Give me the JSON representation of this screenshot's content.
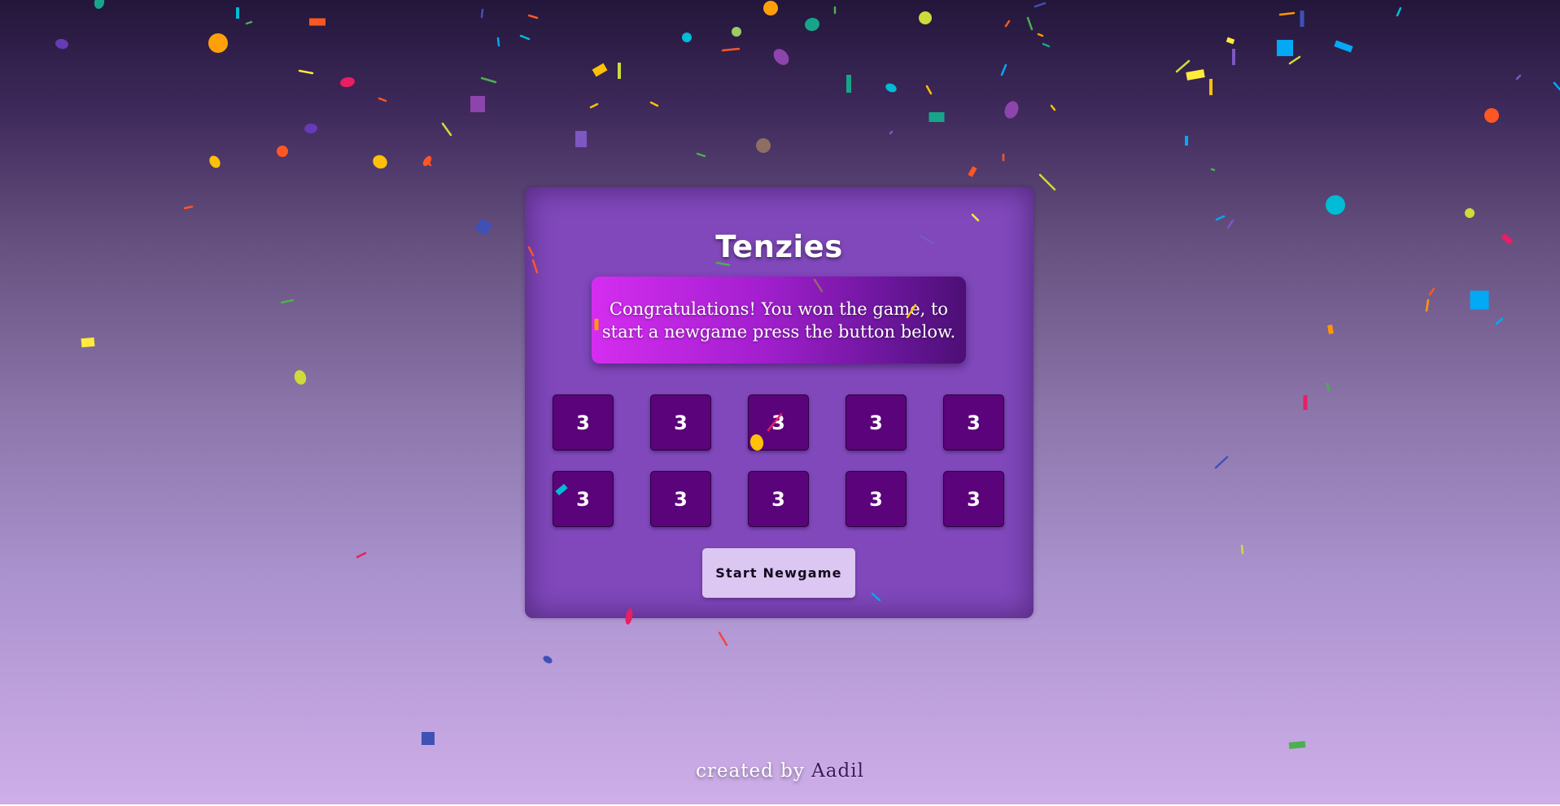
{
  "app": {
    "title": "Tenzies",
    "message": "Congratulations! You won the game, to start a newgame press the button below.",
    "button_label": "Start Newgame"
  },
  "dice": [
    {
      "value": "3"
    },
    {
      "value": "3"
    },
    {
      "value": "3"
    },
    {
      "value": "3"
    },
    {
      "value": "3"
    },
    {
      "value": "3"
    },
    {
      "value": "3"
    },
    {
      "value": "3"
    },
    {
      "value": "3"
    },
    {
      "value": "3"
    }
  ],
  "footer": {
    "prefix": "created by",
    "author": "Aadil"
  },
  "colors": {
    "card": "#8048bb",
    "die": "#5b037a",
    "message_gradient_start": "#d52df0",
    "message_gradient_end": "#4c0f76",
    "button": "#dcc6f2"
  }
}
